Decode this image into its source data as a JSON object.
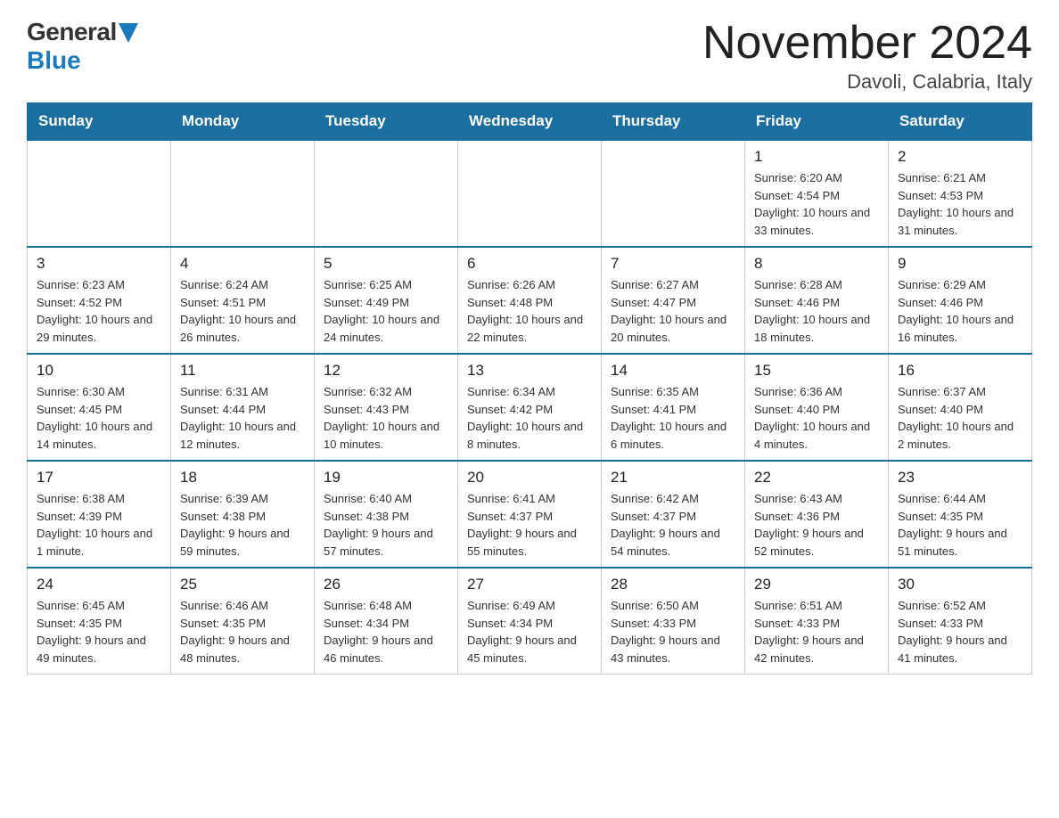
{
  "logo": {
    "general": "General",
    "blue": "Blue"
  },
  "header": {
    "month_year": "November 2024",
    "location": "Davoli, Calabria, Italy"
  },
  "days_of_week": [
    "Sunday",
    "Monday",
    "Tuesday",
    "Wednesday",
    "Thursday",
    "Friday",
    "Saturday"
  ],
  "weeks": [
    {
      "days": [
        {
          "number": "",
          "info": "",
          "empty": true
        },
        {
          "number": "",
          "info": "",
          "empty": true
        },
        {
          "number": "",
          "info": "",
          "empty": true
        },
        {
          "number": "",
          "info": "",
          "empty": true
        },
        {
          "number": "",
          "info": "",
          "empty": true
        },
        {
          "number": "1",
          "info": "Sunrise: 6:20 AM\nSunset: 4:54 PM\nDaylight: 10 hours and 33 minutes."
        },
        {
          "number": "2",
          "info": "Sunrise: 6:21 AM\nSunset: 4:53 PM\nDaylight: 10 hours and 31 minutes."
        }
      ]
    },
    {
      "days": [
        {
          "number": "3",
          "info": "Sunrise: 6:23 AM\nSunset: 4:52 PM\nDaylight: 10 hours and 29 minutes."
        },
        {
          "number": "4",
          "info": "Sunrise: 6:24 AM\nSunset: 4:51 PM\nDaylight: 10 hours and 26 minutes."
        },
        {
          "number": "5",
          "info": "Sunrise: 6:25 AM\nSunset: 4:49 PM\nDaylight: 10 hours and 24 minutes."
        },
        {
          "number": "6",
          "info": "Sunrise: 6:26 AM\nSunset: 4:48 PM\nDaylight: 10 hours and 22 minutes."
        },
        {
          "number": "7",
          "info": "Sunrise: 6:27 AM\nSunset: 4:47 PM\nDaylight: 10 hours and 20 minutes."
        },
        {
          "number": "8",
          "info": "Sunrise: 6:28 AM\nSunset: 4:46 PM\nDaylight: 10 hours and 18 minutes."
        },
        {
          "number": "9",
          "info": "Sunrise: 6:29 AM\nSunset: 4:46 PM\nDaylight: 10 hours and 16 minutes."
        }
      ]
    },
    {
      "days": [
        {
          "number": "10",
          "info": "Sunrise: 6:30 AM\nSunset: 4:45 PM\nDaylight: 10 hours and 14 minutes."
        },
        {
          "number": "11",
          "info": "Sunrise: 6:31 AM\nSunset: 4:44 PM\nDaylight: 10 hours and 12 minutes."
        },
        {
          "number": "12",
          "info": "Sunrise: 6:32 AM\nSunset: 4:43 PM\nDaylight: 10 hours and 10 minutes."
        },
        {
          "number": "13",
          "info": "Sunrise: 6:34 AM\nSunset: 4:42 PM\nDaylight: 10 hours and 8 minutes."
        },
        {
          "number": "14",
          "info": "Sunrise: 6:35 AM\nSunset: 4:41 PM\nDaylight: 10 hours and 6 minutes."
        },
        {
          "number": "15",
          "info": "Sunrise: 6:36 AM\nSunset: 4:40 PM\nDaylight: 10 hours and 4 minutes."
        },
        {
          "number": "16",
          "info": "Sunrise: 6:37 AM\nSunset: 4:40 PM\nDaylight: 10 hours and 2 minutes."
        }
      ]
    },
    {
      "days": [
        {
          "number": "17",
          "info": "Sunrise: 6:38 AM\nSunset: 4:39 PM\nDaylight: 10 hours and 1 minute."
        },
        {
          "number": "18",
          "info": "Sunrise: 6:39 AM\nSunset: 4:38 PM\nDaylight: 9 hours and 59 minutes."
        },
        {
          "number": "19",
          "info": "Sunrise: 6:40 AM\nSunset: 4:38 PM\nDaylight: 9 hours and 57 minutes."
        },
        {
          "number": "20",
          "info": "Sunrise: 6:41 AM\nSunset: 4:37 PM\nDaylight: 9 hours and 55 minutes."
        },
        {
          "number": "21",
          "info": "Sunrise: 6:42 AM\nSunset: 4:37 PM\nDaylight: 9 hours and 54 minutes."
        },
        {
          "number": "22",
          "info": "Sunrise: 6:43 AM\nSunset: 4:36 PM\nDaylight: 9 hours and 52 minutes."
        },
        {
          "number": "23",
          "info": "Sunrise: 6:44 AM\nSunset: 4:35 PM\nDaylight: 9 hours and 51 minutes."
        }
      ]
    },
    {
      "days": [
        {
          "number": "24",
          "info": "Sunrise: 6:45 AM\nSunset: 4:35 PM\nDaylight: 9 hours and 49 minutes."
        },
        {
          "number": "25",
          "info": "Sunrise: 6:46 AM\nSunset: 4:35 PM\nDaylight: 9 hours and 48 minutes."
        },
        {
          "number": "26",
          "info": "Sunrise: 6:48 AM\nSunset: 4:34 PM\nDaylight: 9 hours and 46 minutes."
        },
        {
          "number": "27",
          "info": "Sunrise: 6:49 AM\nSunset: 4:34 PM\nDaylight: 9 hours and 45 minutes."
        },
        {
          "number": "28",
          "info": "Sunrise: 6:50 AM\nSunset: 4:33 PM\nDaylight: 9 hours and 43 minutes."
        },
        {
          "number": "29",
          "info": "Sunrise: 6:51 AM\nSunset: 4:33 PM\nDaylight: 9 hours and 42 minutes."
        },
        {
          "number": "30",
          "info": "Sunrise: 6:52 AM\nSunset: 4:33 PM\nDaylight: 9 hours and 41 minutes."
        }
      ]
    }
  ]
}
